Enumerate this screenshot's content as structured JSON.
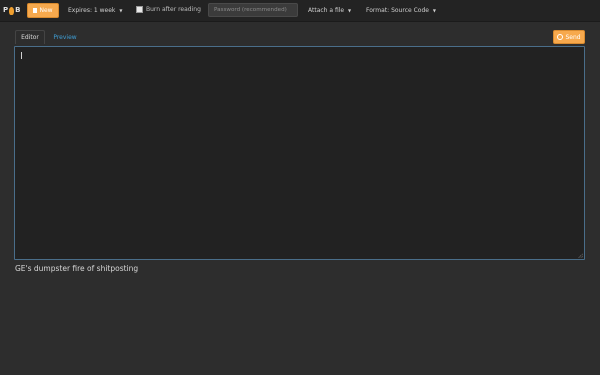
{
  "navbar": {
    "new_label": "New",
    "expires_label": "Expires: 1 week",
    "burn_label": "Burn after reading",
    "password_placeholder": "Password (recommended)",
    "attach_label": "Attach a file",
    "format_label": "Format: Source Code"
  },
  "tabs": {
    "editor_label": "Editor",
    "preview_label": "Preview"
  },
  "actions": {
    "send_label": "Send"
  },
  "editor": {
    "value": ""
  },
  "footer": {
    "text": "GE's dumpster fire of shitposting"
  },
  "colors": {
    "accent": "#f7a94d",
    "link": "#3fa0d8",
    "background": "#2d2d2d",
    "navbar": "#232323",
    "editor": "#222222"
  },
  "icons": {
    "logo": "site-logo",
    "new": "file-icon",
    "send": "send-icon"
  }
}
